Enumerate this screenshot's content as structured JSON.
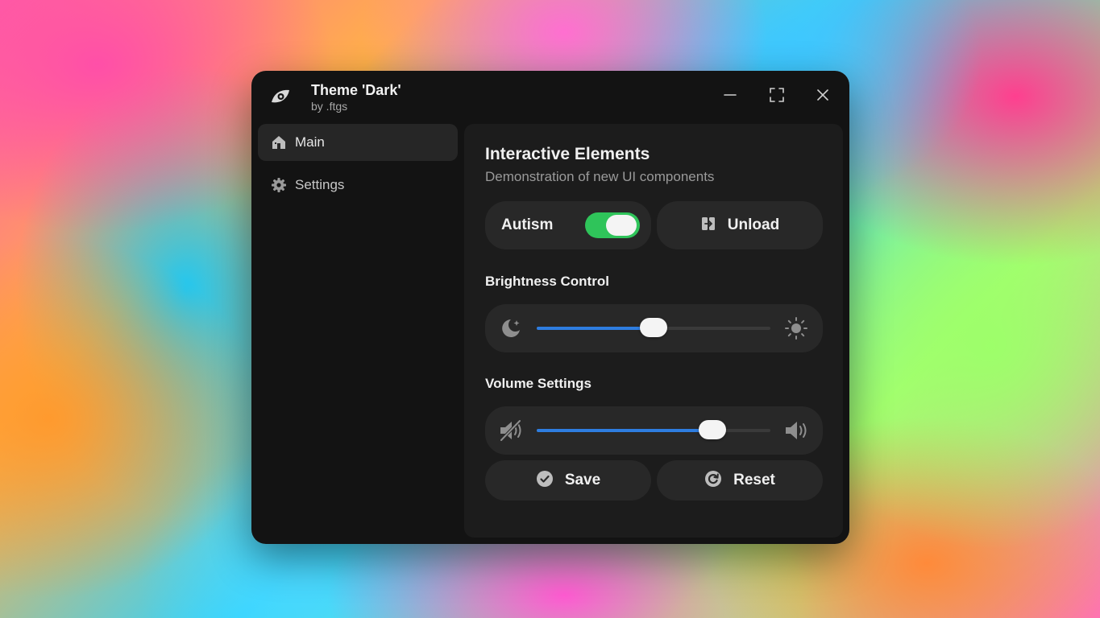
{
  "window": {
    "title": "Theme 'Dark'",
    "subtitle": "by .ftgs",
    "logo_icon": "eye-logo-icon",
    "controls": [
      "minimize-icon",
      "maximize-icon",
      "close-icon"
    ]
  },
  "sidebar": {
    "items": [
      {
        "label": "Main",
        "icon": "home-icon",
        "active": true
      },
      {
        "label": "Settings",
        "icon": "gear-icon",
        "active": false
      }
    ]
  },
  "main": {
    "title": "Interactive Elements",
    "description": "Demonstration of new UI components",
    "toggle": {
      "label": "Autism",
      "on": true
    },
    "unload_button": {
      "label": "Unload",
      "icon": "unload-icon"
    },
    "brightness": {
      "title": "Brightness Control",
      "value_percent": 50,
      "left_icon": "moon-icon",
      "right_icon": "sun-icon"
    },
    "volume": {
      "title": "Volume Settings",
      "value_percent": 75,
      "left_icon": "speaker-muted-icon",
      "right_icon": "speaker-loud-icon"
    },
    "save_button": {
      "label": "Save",
      "icon": "checkmark-circle-icon"
    },
    "reset_button": {
      "label": "Reset",
      "icon": "reset-icon"
    }
  },
  "colors": {
    "accent": "#2e7de0",
    "toggle_on": "#2fc45a",
    "window_bg": "#131313",
    "panel_bg": "#1c1c1c",
    "control_bg": "#282828"
  }
}
